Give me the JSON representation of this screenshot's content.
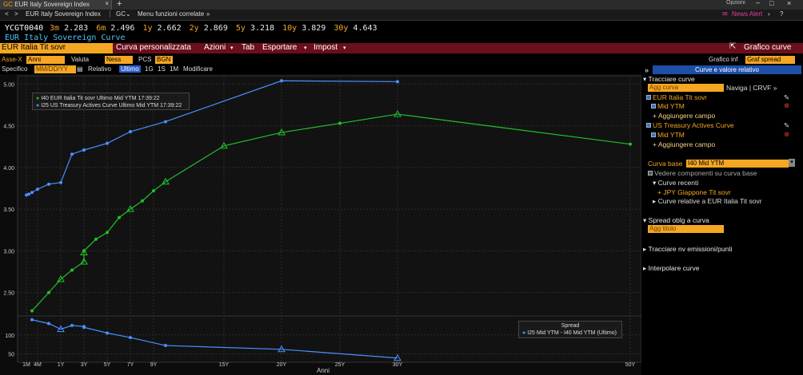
{
  "window": {
    "tab_label": "EUR Italy Sovereign Index",
    "tab_code": "GC",
    "new_tab": "+",
    "options_label": "Opzioni"
  },
  "nav": {
    "back": "<",
    "forward": ">",
    "security": "EUR Italy Sovereign Index",
    "function": "GC",
    "related_menu": "Menu funzioni correlate",
    "news_alert": "News Alert"
  },
  "ticker": {
    "code": "YCGT0040",
    "items": [
      {
        "tenor": "3m",
        "value": "2.283"
      },
      {
        "tenor": "6m",
        "value": "2.496"
      },
      {
        "tenor": "1y",
        "value": "2.662"
      },
      {
        "tenor": "2y",
        "value": "2.869"
      },
      {
        "tenor": "5y",
        "value": "3.218"
      },
      {
        "tenor": "10y",
        "value": "3.829"
      },
      {
        "tenor": "30y",
        "value": "4.643"
      }
    ],
    "subtitle": "EUR Italy Sovereign Curve"
  },
  "menubar": {
    "curve_field": "EUR Italia Tit sovr",
    "custom_curve": "Curva personalizzata",
    "actions": "Azioni",
    "tab": "Tab",
    "export": "Esportare",
    "settings": "Impost",
    "chart_curves": "Grafico curve"
  },
  "controls": {
    "x_axis_label": "Asse-X",
    "x_axis_value": "Anni",
    "currency_label": "Valuta",
    "currency_value": "Ness",
    "pcs_label": "PCS",
    "pcs_value": "BGN",
    "lower_chart_label": "Grafico inf",
    "lower_chart_value": "Graf spread",
    "specific_label": "Specifico",
    "date_placeholder": "MM/DD/YY",
    "relative_label": "Relativo",
    "ranges": [
      "Ultimo",
      "1G",
      "1S",
      "1M"
    ],
    "modify_label": "Modificare"
  },
  "panel": {
    "header": "Curve e valore relativo",
    "collapse": "»",
    "trace_curves": "Tracciare curve",
    "add_curve_placeholder": "Agg curva",
    "naviga": "Naviga | CRVF »",
    "curve1": "EUR Italia Tit sovr",
    "curve1_field": "Mid YTM",
    "add_field": "+ Aggiungere campo",
    "curve2": "US Treasury Actives Curve",
    "curve2_field": "Mid YTM",
    "add_field2": "+ Aggiungere campo",
    "base_curve_label": "Curva base",
    "base_curve_value": "I40 Mid YTM",
    "base_components": "Vedere componenti su curva base",
    "recent_curves": "Curve recenti",
    "recent_item": "+ JPY Giappone Tit sovr",
    "related_curves": "Curve relative a EUR Italia Tit sovr",
    "spread_section": "Spread oblg a curva",
    "add_title_placeholder": "Agg titolo",
    "trace_new": "Tracciare nv emissioni/punti",
    "interpolate": "Interpolare curve"
  },
  "chart_data": [
    {
      "type": "line",
      "legend_placement": "top-left",
      "xlabel": "Anni",
      "ylim": [
        2.2,
        5.1
      ],
      "yticks": [
        "5.00",
        "4.50",
        "4.00",
        "3.50",
        "3.00",
        "2.50"
      ],
      "series": [
        {
          "name": "I40 EUR Italia Tit sovr Ultimo Mid YTM 17:39:22",
          "color": "#22c02a",
          "x": [
            "3M",
            "6M",
            "1Y",
            "18M",
            "2Y",
            "30M",
            "3Y",
            "4Y",
            "5Y",
            "6Y",
            "7Y",
            "8Y",
            "9Y",
            "10Y",
            "15Y",
            "20Y",
            "25Y",
            "30Y",
            "50Y"
          ],
          "values": [
            2.28,
            2.5,
            2.66,
            2.77,
            2.87,
            2.98,
            3.0,
            3.14,
            3.22,
            3.4,
            3.5,
            3.6,
            3.72,
            3.83,
            4.26,
            4.42,
            4.53,
            4.64,
            4.28
          ]
        },
        {
          "name": "I25 US Treasury Actives Curve Ultimo Mid YTM 17:39:22",
          "color": "#4a90ff",
          "x": [
            "1M",
            "2M",
            "3M",
            "4M",
            "6M",
            "1Y",
            "18M",
            "2Y",
            "3Y",
            "5Y",
            "7Y",
            "10Y",
            "20Y",
            "30Y"
          ],
          "values": [
            3.67,
            3.68,
            3.7,
            3.74,
            3.8,
            3.82,
            4.16,
            4.21,
            4.21,
            4.29,
            4.43,
            4.55,
            5.04,
            5.03
          ]
        }
      ]
    },
    {
      "type": "line",
      "title": "Spread",
      "legend_placement": "bottom-right",
      "yticks": [
        "100",
        "50"
      ],
      "ylim": [
        30,
        150
      ],
      "series": [
        {
          "name": "I25 Mid YTM - I40 Mid YTM (Ultimo)",
          "color": "#4a90ff",
          "x": [
            "3M",
            "6M",
            "1Y",
            "18M",
            "2Y",
            "3Y",
            "5Y",
            "7Y",
            "10Y",
            "20Y",
            "30Y"
          ],
          "values": [
            140,
            130,
            115,
            125,
            122,
            120,
            105,
            93,
            72,
            62,
            39
          ]
        }
      ]
    }
  ],
  "x_ticks": [
    "1M",
    "4M",
    "1Y",
    "3Y",
    "5Y",
    "7Y",
    "9Y",
    "15Y",
    "20Y",
    "25Y",
    "30Y",
    "50Y"
  ]
}
